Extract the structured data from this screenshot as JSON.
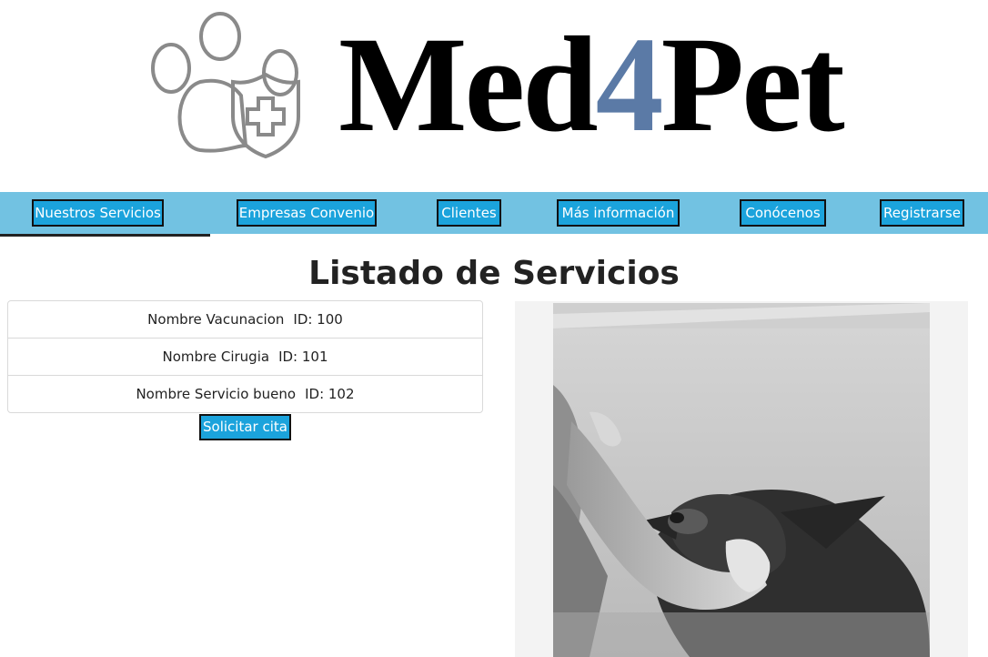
{
  "brand": {
    "name_part1": "Med",
    "name_digit": "4",
    "name_part2": "Pet",
    "logo_icon": "paw-shield-cross-icon",
    "accent_color": "#5b7aa6"
  },
  "nav": {
    "bar_color": "#72c2e2",
    "button_color": "#1ba3dc",
    "items": [
      {
        "label": "Nuestros Servicios",
        "active": true
      },
      {
        "label": "Empresas Convenio"
      },
      {
        "label": "Clientes"
      },
      {
        "label": "Más información"
      },
      {
        "label": "Conócenos"
      },
      {
        "label": "Registrarse"
      }
    ]
  },
  "main": {
    "title": "Listado de Servicios",
    "services": [
      {
        "name": "Nombre Vacunacion",
        "id": "ID: 100"
      },
      {
        "name": "Nombre Cirugia",
        "id": "ID: 101"
      },
      {
        "name": "Nombre Servicio bueno",
        "id": "ID: 102"
      }
    ],
    "cta_label": "Solicitar cita",
    "photo": "dog-with-vet-hand-photo"
  }
}
